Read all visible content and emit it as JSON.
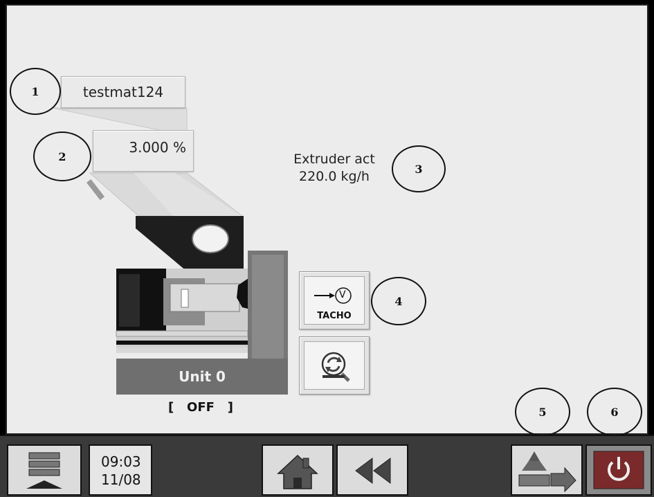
{
  "material": {
    "name": "testmat124"
  },
  "dosing": {
    "percent": "3.000 %"
  },
  "extruder": {
    "label": "Extruder act",
    "value": "220.0 kg/h"
  },
  "unit": {
    "name": "Unit 0",
    "status": "[   OFF   ]"
  },
  "buttons": {
    "tacho_label": "TACHO",
    "tacho_symbol": "V"
  },
  "taskbar": {
    "time": "09:03",
    "date": "11/08"
  },
  "callouts": [
    "1",
    "2",
    "3",
    "4",
    "5",
    "6"
  ],
  "icons": {
    "menu": "menu-list-icon",
    "home": "home-icon",
    "back": "rewind-icon",
    "tacho": "tacho-icon",
    "refresh": "refresh-search-icon",
    "transfer": "material-transfer-icon",
    "power": "power-icon"
  },
  "colors": {
    "panel": "#ececec",
    "taskbar": "#3a3a3a",
    "unit_bar": "#6f6f6f",
    "power_red": "#7a2a2a"
  }
}
